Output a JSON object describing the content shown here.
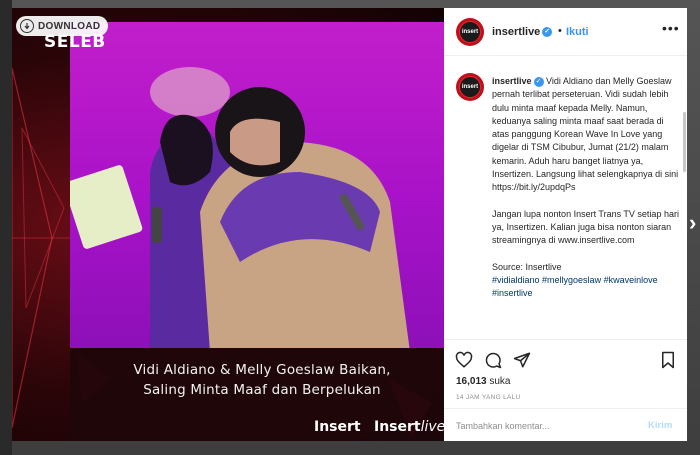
{
  "overlay": {
    "download_label": "DOWNLOAD",
    "icons": {
      "download": "download-arrow-icon",
      "next": "chevron-right-icon"
    }
  },
  "media": {
    "brand_label": "SELEB",
    "subtitle_line1": "Vidi Aldiano & Melly Goeslaw Baikan,",
    "subtitle_line2": "Saling Minta Maaf dan Berpelukan",
    "logo_insert": "Insert",
    "logo_insertlive_a": "Insert",
    "logo_insertlive_b": "live",
    "colors": {
      "stage": "#c21ecb",
      "frame": "#6a0d16"
    }
  },
  "post": {
    "header": {
      "username": "insertlive",
      "dot": "•",
      "follow_label": "Ikuti",
      "more_icon": "more-horizontal-icon"
    },
    "caption": {
      "username": "insertlive",
      "para1": "Vidi Aldiano dan Melly Goeslaw pernah terlibat perseteruan. Vidi sudah lebih dulu minta maaf kepada Melly. Namun, keduanya saling minta maaf saat berada di atas panggung Korean Wave In Love yang digelar di TSM Cibubur, Jumat (21/2) malam kemarin. Aduh haru banget liatnya ya, Insertizen. Langsung lihat selengkapnya di sini https://bit.ly/2updqPs",
      "para2": "Jangan lupa nonton Insert Trans TV setiap hari ya, Insertizen. Kalian juga bisa nonton siaran streamingnya di www.insertlive.com",
      "source": "Source: Insertlive",
      "hashtags": "#vidialdiano #mellygoeslaw #kwaveinlove #insertlive"
    },
    "actions": {
      "likes_count": "16,013",
      "likes_suffix": " suka",
      "time_ago": "14 JAM YANG LALU",
      "comment_placeholder": "Tambahkan komentar...",
      "post_label": "Kirim"
    },
    "colors": {
      "link": "#3897f0",
      "hashtag": "#00376b",
      "avatar_ring": "#c0101a"
    }
  }
}
